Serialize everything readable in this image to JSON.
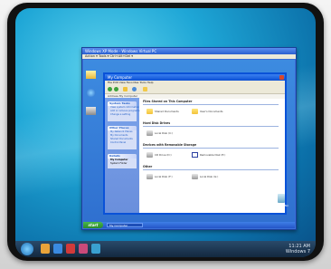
{
  "vm_window": {
    "title": "Windows XP Mode - Windows Virtual PC",
    "menu": "Action ▾  Tools ▾  Ctrl+Alt+Del ▾"
  },
  "xp_desktop": {
    "icons": [
      "My Documents",
      "Internet Explorer",
      "Recycle Bin"
    ],
    "start_label": "start",
    "taskbar_item": "My Computer",
    "recycle_label": "Recycle Bin"
  },
  "explorer": {
    "title": "My Computer",
    "menu": "File  Edit  View  Favorites  Tools  Help",
    "address": "Address  My Computer",
    "tasks_panel": {
      "header": "System Tasks",
      "items": [
        "View system information",
        "Add or remove programs",
        "Change a setting"
      ]
    },
    "places_panel": {
      "header": "Other Places",
      "items": [
        "My Network Places",
        "My Documents",
        "Shared Documents",
        "Control Panel"
      ]
    },
    "details_panel": {
      "header": "Details",
      "items": [
        "My Computer",
        "System Folder"
      ]
    },
    "sections": [
      {
        "title": "Files Stored on This Computer",
        "items": [
          "Shared Documents",
          "User's Documents"
        ]
      },
      {
        "title": "Hard Disk Drives",
        "items": [
          "Local Disk (C:)"
        ]
      },
      {
        "title": "Devices with Removable Storage",
        "items": [
          "CD Drive (D:)",
          "Removable Disk (E:)"
        ]
      },
      {
        "title": "Other",
        "items": [
          "Local Disk (F:)",
          "Local Disk (G:)"
        ]
      }
    ]
  },
  "host_taskbar": {
    "tray_line1": "11:21 AM",
    "tray_line2": "Windows 7"
  }
}
